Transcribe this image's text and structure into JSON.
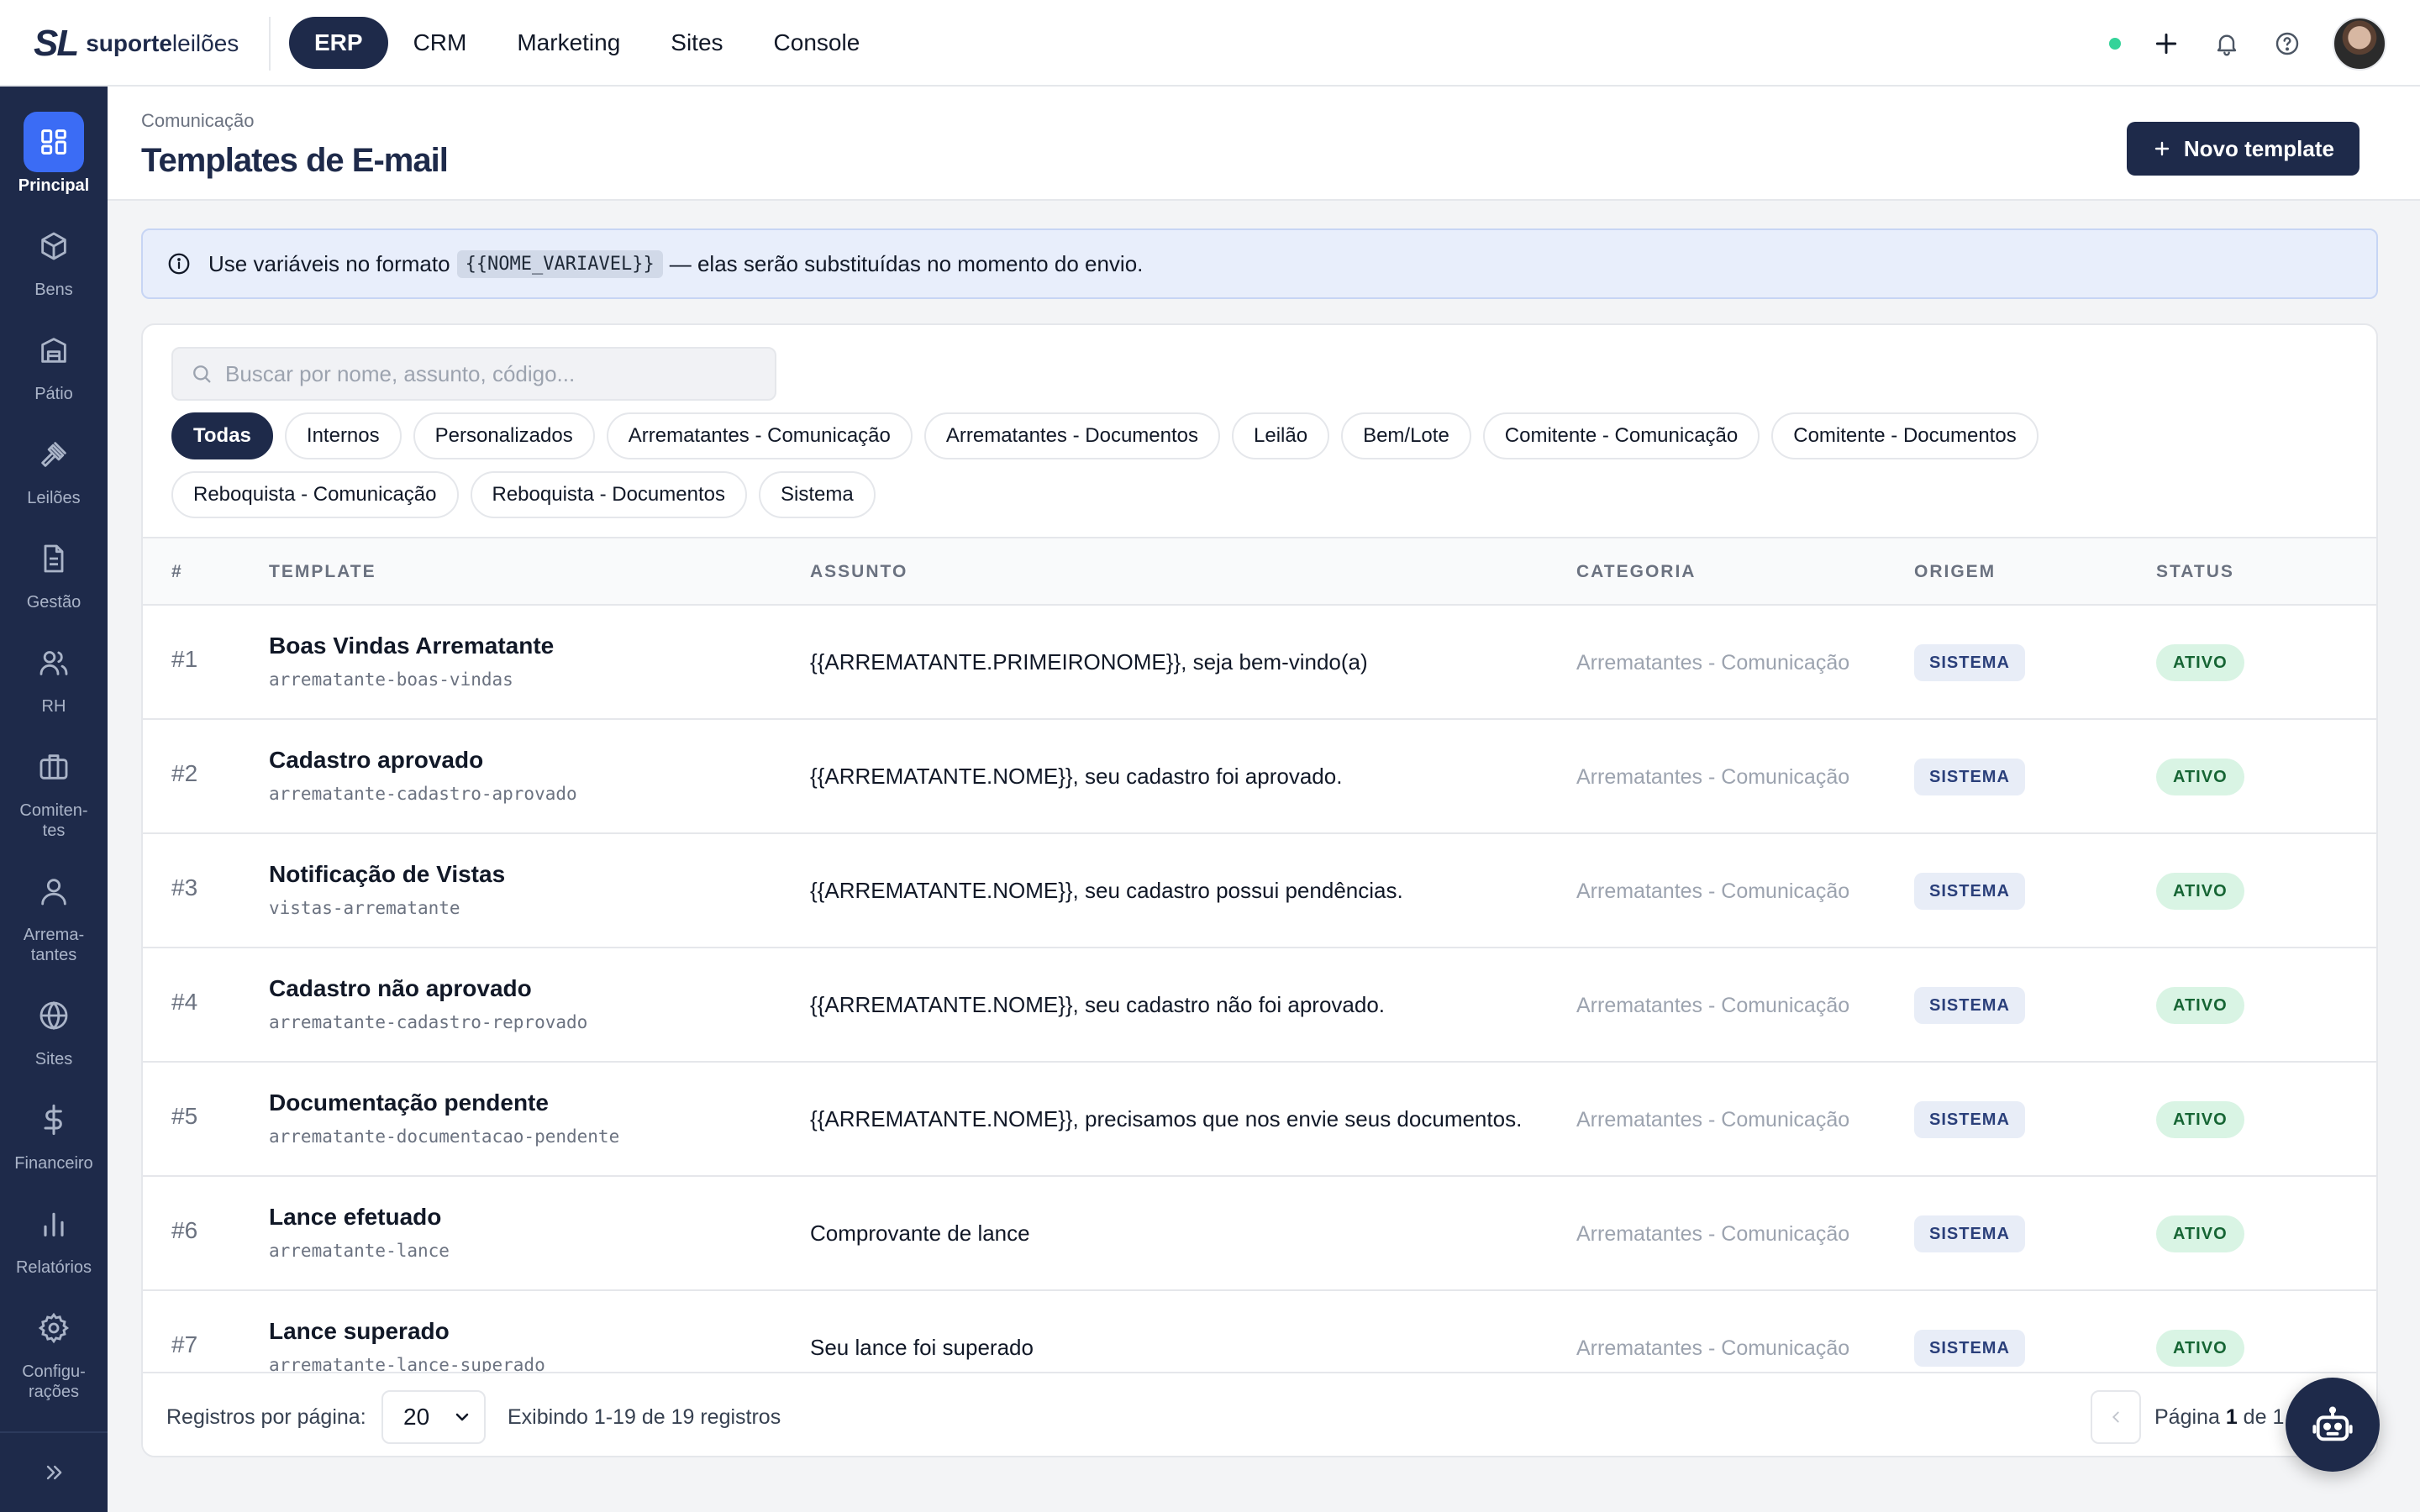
{
  "brand": {
    "mark": "SL",
    "name_bold": "suporte",
    "name_light": "leilões"
  },
  "topnav": [
    {
      "label": "ERP",
      "active": true
    },
    {
      "label": "CRM"
    },
    {
      "label": "Marketing"
    },
    {
      "label": "Sites"
    },
    {
      "label": "Console"
    }
  ],
  "sidebar": [
    {
      "label": "Principal",
      "icon": "grid-icon",
      "active": true
    },
    {
      "label": "Bens",
      "icon": "box-icon"
    },
    {
      "label": "Pátio",
      "icon": "warehouse-icon"
    },
    {
      "label": "Leilões",
      "icon": "gavel-icon"
    },
    {
      "label": "Gestão",
      "icon": "document-icon"
    },
    {
      "label": "RH",
      "icon": "users-icon"
    },
    {
      "label": "Comiten-\ntes",
      "icon": "briefcase-icon"
    },
    {
      "label": "Arrema-\ntantes",
      "icon": "user-icon"
    },
    {
      "label": "Sites",
      "icon": "globe-icon"
    },
    {
      "label": "Financeiro",
      "icon": "dollar-icon"
    },
    {
      "label": "Relatórios",
      "icon": "bar-chart-icon"
    },
    {
      "label": "Configu-\nrações",
      "icon": "gear-icon"
    }
  ],
  "header": {
    "breadcrumb": "Comunicação",
    "title": "Templates de E-mail",
    "new_button": "Novo template"
  },
  "info": {
    "before": "Use variáveis no formato",
    "code": "{{NOME_VARIAVEL}}",
    "after": "— elas serão substituídas no momento do envio."
  },
  "search": {
    "placeholder": "Buscar por nome, assunto, código..."
  },
  "filters": [
    {
      "label": "Todas",
      "active": true
    },
    {
      "label": "Internos"
    },
    {
      "label": "Personalizados"
    },
    {
      "label": "Arrematantes - Comunicação"
    },
    {
      "label": "Arrematantes - Documentos"
    },
    {
      "label": "Leilão"
    },
    {
      "label": "Bem/Lote"
    },
    {
      "label": "Comitente - Comunicação"
    },
    {
      "label": "Comitente - Documentos"
    },
    {
      "label": "Reboquista - Comunicação"
    },
    {
      "label": "Reboquista - Documentos"
    },
    {
      "label": "Sistema"
    }
  ],
  "table": {
    "columns": [
      "#",
      "TEMPLATE",
      "ASSUNTO",
      "CATEGORIA",
      "ORIGEM",
      "STATUS"
    ],
    "rows": [
      {
        "num": "#1",
        "name": "Boas Vindas Arrematante",
        "code": "arrematante-boas-vindas",
        "subject": "{{ARREMATANTE.PRIMEIRONOME}}, seja bem-vindo(a)",
        "category": "Arrematantes - Comunicação",
        "origin": "SISTEMA",
        "status": "ATIVO"
      },
      {
        "num": "#2",
        "name": "Cadastro aprovado",
        "code": "arrematante-cadastro-aprovado",
        "subject": "{{ARREMATANTE.NOME}}, seu cadastro foi aprovado.",
        "category": "Arrematantes - Comunicação",
        "origin": "SISTEMA",
        "status": "ATIVO"
      },
      {
        "num": "#3",
        "name": "Notificação de Vistas",
        "code": "vistas-arrematante",
        "subject": "{{ARREMATANTE.NOME}}, seu cadastro possui pendências.",
        "category": "Arrematantes - Comunicação",
        "origin": "SISTEMA",
        "status": "ATIVO"
      },
      {
        "num": "#4",
        "name": "Cadastro não aprovado",
        "code": "arrematante-cadastro-reprovado",
        "subject": "{{ARREMATANTE.NOME}}, seu cadastro não foi aprovado.",
        "category": "Arrematantes - Comunicação",
        "origin": "SISTEMA",
        "status": "ATIVO"
      },
      {
        "num": "#5",
        "name": "Documentação pendente",
        "code": "arrematante-documentacao-pendente",
        "subject": "{{ARREMATANTE.NOME}}, precisamos que nos envie seus documentos.",
        "category": "Arrematantes - Comunicação",
        "origin": "SISTEMA",
        "status": "ATIVO"
      },
      {
        "num": "#6",
        "name": "Lance efetuado",
        "code": "arrematante-lance",
        "subject": "Comprovante de lance",
        "category": "Arrematantes - Comunicação",
        "origin": "SISTEMA",
        "status": "ATIVO"
      },
      {
        "num": "#7",
        "name": "Lance superado",
        "code": "arrematante-lance-superado",
        "subject": "Seu lance foi superado",
        "category": "Arrematantes - Comunicação",
        "origin": "SISTEMA",
        "status": "ATIVO"
      }
    ]
  },
  "footer": {
    "per_page_label": "Registros por página:",
    "per_page_value": "20",
    "showing": "Exibindo 1-19 de 19 registros",
    "page_prefix": "Página",
    "page_current": "1",
    "page_mid": "de",
    "page_total": "1"
  },
  "colors": {
    "navy": "#1e2a4a",
    "accent": "#3b6cf5",
    "status_green": "#166534",
    "online": "#34d399"
  }
}
